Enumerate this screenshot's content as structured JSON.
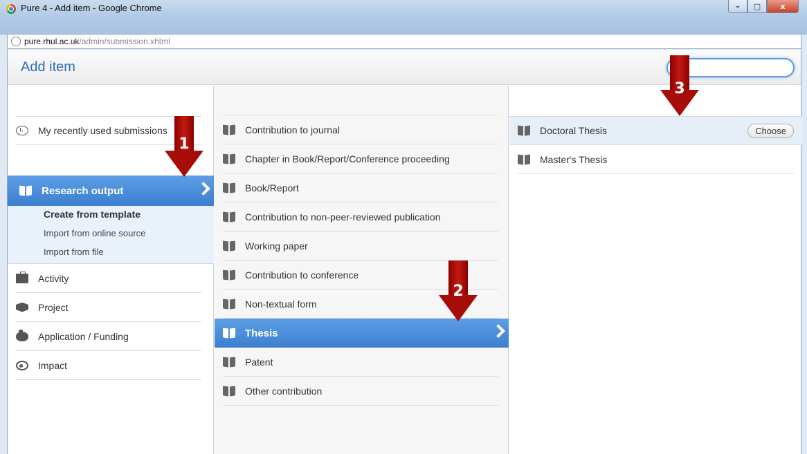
{
  "window": {
    "title": "Pure 4 - Add item - Google Chrome",
    "minimize_label": "–",
    "maximize_label": "□",
    "close_label": "x"
  },
  "address": {
    "host": "pure.rhul.ac.uk",
    "path": "/admin/submission.xhtml"
  },
  "page": {
    "title": "Add item",
    "search_placeholder": ""
  },
  "left_column": {
    "recent": "My recently used submissions",
    "selected": "Research output",
    "submenu": [
      "Create from template",
      "Import from online source",
      "Import from file"
    ],
    "categories": [
      {
        "label": "Activity",
        "icon": "briefcase-icon"
      },
      {
        "label": "Project",
        "icon": "cube-icon"
      },
      {
        "label": "Application / Funding",
        "icon": "moneybag-icon"
      },
      {
        "label": "Impact",
        "icon": "target-icon"
      }
    ]
  },
  "middle_column": {
    "items": [
      "Contribution to journal",
      "Chapter in Book/Report/Conference proceeding",
      "Book/Report",
      "Contribution to non-peer-reviewed publication",
      "Working paper",
      "Contribution to conference",
      "Non-textual form",
      "Thesis",
      "Patent",
      "Other contribution"
    ],
    "selected": "Thesis"
  },
  "right_column": {
    "items": [
      "Doctoral Thesis",
      "Master's Thesis"
    ],
    "choose_label": "Choose"
  },
  "annotations": [
    "1",
    "2",
    "3"
  ],
  "colors": {
    "accent": "#3c7fcf",
    "annotation_arrow": "#a70d08",
    "title_text": "#2a6fb5"
  }
}
